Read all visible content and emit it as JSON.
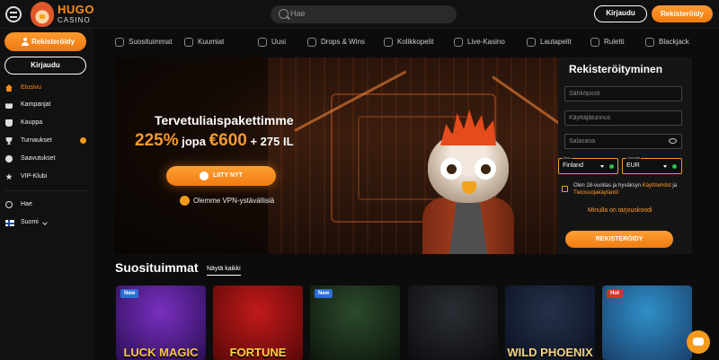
{
  "header": {
    "logo_text": "HUGO",
    "logo_sub": "CASINO",
    "search_placeholder": "Hae",
    "login_label": "Kirjaudu",
    "register_label": "Rekisteröidy"
  },
  "sidebar": {
    "register_label": "Rekisteröidy",
    "login_label": "Kirjaudu",
    "items": [
      {
        "label": "Etusivu",
        "icon": "home-icon",
        "active": true
      },
      {
        "label": "Kampanjat",
        "icon": "gift-icon"
      },
      {
        "label": "Kauppa",
        "icon": "shopping-bag-icon"
      },
      {
        "label": "Turnaukset",
        "icon": "trophy-icon"
      },
      {
        "label": "Saavutukset",
        "icon": "medal-icon"
      },
      {
        "label": "VIP-Klubi",
        "icon": "vip-icon"
      }
    ],
    "search_label": "Hae",
    "language_label": "Suomi"
  },
  "categories": [
    {
      "label": "Suosituimmat",
      "icon": "popular-icon"
    },
    {
      "label": "Kuumiat",
      "icon": "fire-icon"
    },
    {
      "label": "Uusi",
      "icon": "new-icon"
    },
    {
      "label": "Drops & Wins",
      "icon": "drops-icon"
    },
    {
      "label": "Kolikkopelit",
      "icon": "slots-icon"
    },
    {
      "label": "Live-Kasino",
      "icon": "live-icon"
    },
    {
      "label": "Lautapelit",
      "icon": "table-games-icon"
    },
    {
      "label": "Ruletti",
      "icon": "roulette-icon"
    },
    {
      "label": "Blackjack",
      "icon": "cards-icon"
    }
  ],
  "hero": {
    "title": "Tervetuliaispakettimme",
    "offer_percent": "225%",
    "offer_mid": " jopa ",
    "offer_amount": "€600",
    "offer_extra": " + 275 IL",
    "cta_label": "LIITY NYT",
    "vpn_text": "Olemme VPN-ystävällisiä"
  },
  "registration": {
    "title": "Rekisteröityminen",
    "email_placeholder": "Sähköposti",
    "username_placeholder": "Käyttäjätunnus",
    "password_placeholder": "Salasana",
    "country_label": "Maa",
    "country_value": "Finland",
    "currency_label": "Valuutta",
    "currency_value": "EUR",
    "terms_prefix": "Olen 18-vuotias ja hyväksyn ",
    "terms_link": "Käyttöehdot",
    "terms_mid": " ja ",
    "privacy_link": "Tietosuojakäytäntö",
    "promo_link": "Minulla on tarjouskoodi",
    "submit_label": "REKISTERÖIDY"
  },
  "popular": {
    "title": "Suosituimmat",
    "view_all": "Näytä kaikki",
    "games": [
      {
        "name": "LUCK MAGIC",
        "badge": "New",
        "badge_type": "new",
        "colors": [
          "#7a2fbf",
          "#2a0f55"
        ],
        "text_color": "#f5c542"
      },
      {
        "name": "FORTUNE",
        "badge": "",
        "badge_type": "",
        "colors": [
          "#c11a1a",
          "#5a0808"
        ],
        "text_color": "#ffd23a"
      },
      {
        "name": "",
        "badge": "New",
        "badge_type": "new",
        "colors": [
          "#2b4a2a",
          "#0d160d"
        ],
        "text_color": "#9be15d"
      },
      {
        "name": "",
        "badge": "",
        "badge_type": "",
        "colors": [
          "#2a2d33",
          "#0c0d10"
        ],
        "text_color": "#ddd"
      },
      {
        "name": "WILD PHOENIX",
        "badge": "",
        "badge_type": "",
        "colors": [
          "#25314a",
          "#0b1020"
        ],
        "text_color": "#f3d37a"
      },
      {
        "name": "",
        "badge": "Hot",
        "badge_type": "hot",
        "colors": [
          "#2f90c9",
          "#1a3f6a"
        ],
        "text_color": "#ffd23a"
      }
    ]
  }
}
